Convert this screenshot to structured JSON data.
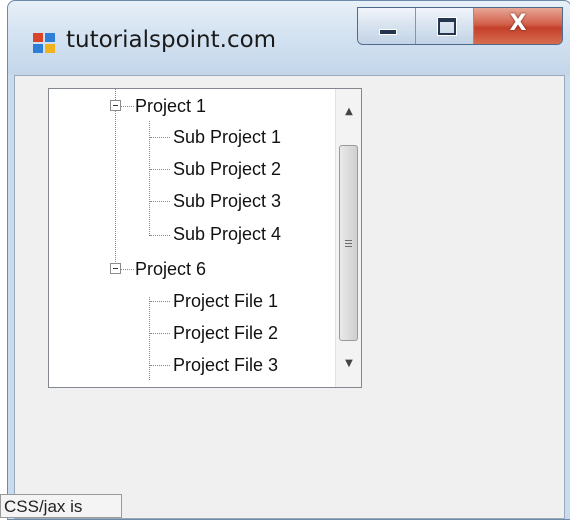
{
  "window": {
    "title": "tutorialspoint.com",
    "icon": "windows-form-icon",
    "controls": {
      "minimize": "minimize-icon",
      "maximize": "maximize-icon",
      "close_label": "X"
    }
  },
  "tree": {
    "nodes": [
      {
        "label": "Project 1",
        "expanded": true,
        "children": [
          "Sub Project 1",
          "Sub Project 2",
          "Sub Project 3",
          "Sub Project 4"
        ]
      },
      {
        "label": "Project 6",
        "expanded": true,
        "children": [
          "Project File 1",
          "Project File 2",
          "Project File 3"
        ]
      }
    ]
  },
  "scrollbar": {
    "up": "scroll-up-icon",
    "down": "scroll-down-icon"
  },
  "overlay": {
    "tooltip": "CSS/jax is"
  }
}
